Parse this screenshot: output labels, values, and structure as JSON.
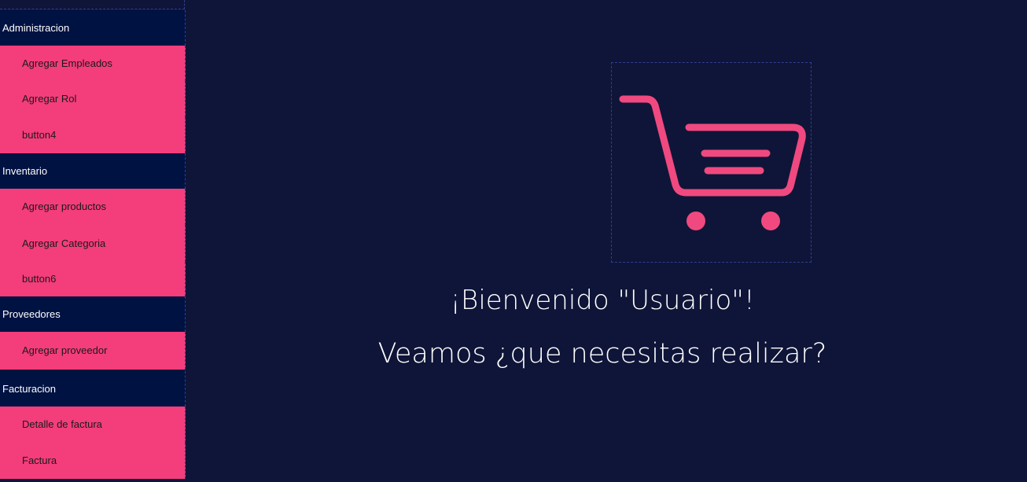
{
  "sidebar": {
    "sections": [
      {
        "label": "Administracion",
        "items": [
          "Agregar Empleados",
          "Agregar Rol",
          "button4"
        ]
      },
      {
        "label": "Inventario",
        "items": [
          "Agregar productos",
          "Agregar Categoria",
          "button6"
        ]
      },
      {
        "label": "Proveedores",
        "items": [
          "Agregar proveedor"
        ]
      },
      {
        "label": "Facturacion",
        "items": [
          "Detalle de factura",
          "Factura"
        ]
      }
    ]
  },
  "main": {
    "logo_icon": "shopping-cart-icon",
    "welcome_line1": "¡Bienvenido \"Usuario\"!",
    "welcome_line2": "Veamos ¿que necesitas realizar?"
  },
  "colors": {
    "background": "#0f1538",
    "section_header": "#001242",
    "accent": "#f43d7b",
    "text_light": "#ffffff",
    "text_dark": "#1a1a1a"
  }
}
